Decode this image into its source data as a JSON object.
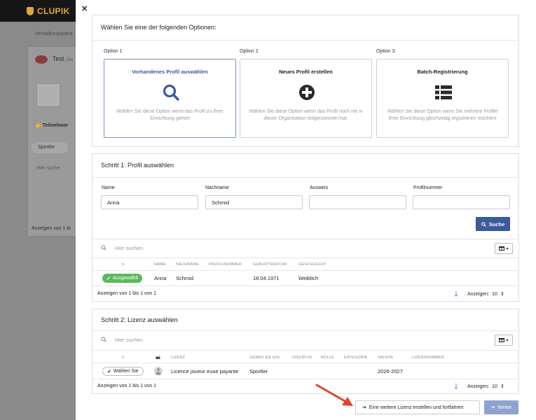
{
  "background": {
    "brand": "CLUPIK",
    "breadcrumb": "Verwaltungspane",
    "card_title": "Test",
    "card_title_suffix": "(Sw",
    "tab_label": "Teilnehmer",
    "chip_label": "Sportler",
    "search_placeholder": "Hier suche",
    "footer": "Anzeigen von 1 bi"
  },
  "modal": {
    "close_glyph": "✕",
    "choose_title": "Wählen Sie eine der folgenden Optionen:",
    "options": [
      {
        "label": "Option 1",
        "title": "Vorhandenes Profil auswählen",
        "description": "Wählen Sie diese Option wenn das Profil zu Ihrer Einrichtung gehört",
        "icon": "search-icon"
      },
      {
        "label": "Option 2",
        "title": "Neues Profil erstellen",
        "description": "Wählen Sie diese Option wenn das Profil noch nie in dieser Organisation teilgenommen hat.",
        "icon": "plus-circle-icon"
      },
      {
        "label": "Option 3",
        "title": "Batch-Registrierung",
        "description": "Wählen Sie diese Option wenn Sie mehrere Profile Ihrer Einrichtung gleichzeitig registrieren möchten",
        "icon": "list-icon"
      }
    ],
    "selected_option": 1
  },
  "step1": {
    "title": "Schritt 1: Profil auswählen",
    "fields": [
      {
        "label": "Name",
        "value": "Anna"
      },
      {
        "label": "Nachname",
        "value": "Schmid"
      },
      {
        "label": "Ausweis",
        "value": ""
      },
      {
        "label": "Profilnummer",
        "value": ""
      }
    ],
    "search_button": "Suche",
    "table": {
      "search_placeholder": "Hier suchen",
      "headers": [
        "ϟ",
        "NAME",
        "NACHNAME",
        "PROFILNUMMER",
        "GEBURTSDATUM",
        "GESCHLECHT"
      ],
      "rows": [
        {
          "action": "Ausgewählt",
          "name": "Anna",
          "nachname": "Schmid",
          "profilnummer": "",
          "geburtsdatum": "18.04.1971",
          "geschlecht": "Weiblich"
        }
      ],
      "info": "Anzeigen von 1 bis 1 von 1",
      "page": "1",
      "per_page_label": "Anzeigen:",
      "per_page_value": "10"
    }
  },
  "step2": {
    "title": "Schritt 2: Lizenz auswählen",
    "table": {
      "search_placeholder": "Hier suchen",
      "headers": [
        "ϟ",
        "📷",
        "LIZENZ",
        "GEBEN SIE EIN.",
        "DISZIPLIN",
        "ROLLE",
        "KATEGORIE",
        "SAISON",
        "LIZENZNUMMER"
      ],
      "rows": [
        {
          "action": "Wählen Sie",
          "lizenz": "Licence joueur·euse payante",
          "typ": "Sportler",
          "disziplin": "",
          "rolle": "",
          "kategorie": "",
          "saison": "2026-2027",
          "lizenznummer": ""
        }
      ],
      "info": "Anzeigen von 1 bis 1 von 1",
      "page": "1",
      "per_page_label": "Anzeigen:",
      "per_page_value": "10"
    }
  },
  "footer": {
    "create_another": "Eine weitere Lizenz erstellen und fortfahren",
    "next": "Weiter"
  },
  "colors": {
    "primary": "#3b5b9e",
    "success": "#5cb85c",
    "annotation_arrow": "#e0442c"
  }
}
